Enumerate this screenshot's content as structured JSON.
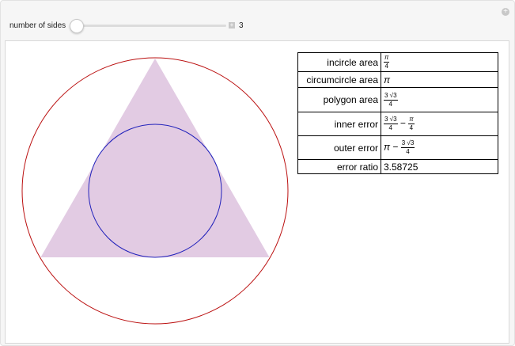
{
  "controls": {
    "label": "number of sides",
    "value": "3",
    "slider_fraction": 0
  },
  "colors": {
    "polygon": "#e2cbe3",
    "incircle": "#2222bb",
    "circumcircle": "#bb1111"
  },
  "table": [
    {
      "label": "incircle area",
      "value": {
        "num": "π",
        "den": "4"
      }
    },
    {
      "label": "circumcircle area",
      "value": {
        "text": "π"
      }
    },
    {
      "label": "polygon area",
      "value": {
        "num": "3 √3",
        "den": "4"
      }
    },
    {
      "label": "inner error",
      "value": {
        "num": "3 √3",
        "den": "4",
        "op": "−",
        "num2": "π",
        "den2": "4"
      }
    },
    {
      "label": "outer error",
      "value": {
        "pre": "π",
        "op": "−",
        "num": "3 √3",
        "den": "4"
      }
    },
    {
      "label": "error ratio",
      "value": {
        "text": "3.58725"
      }
    }
  ]
}
